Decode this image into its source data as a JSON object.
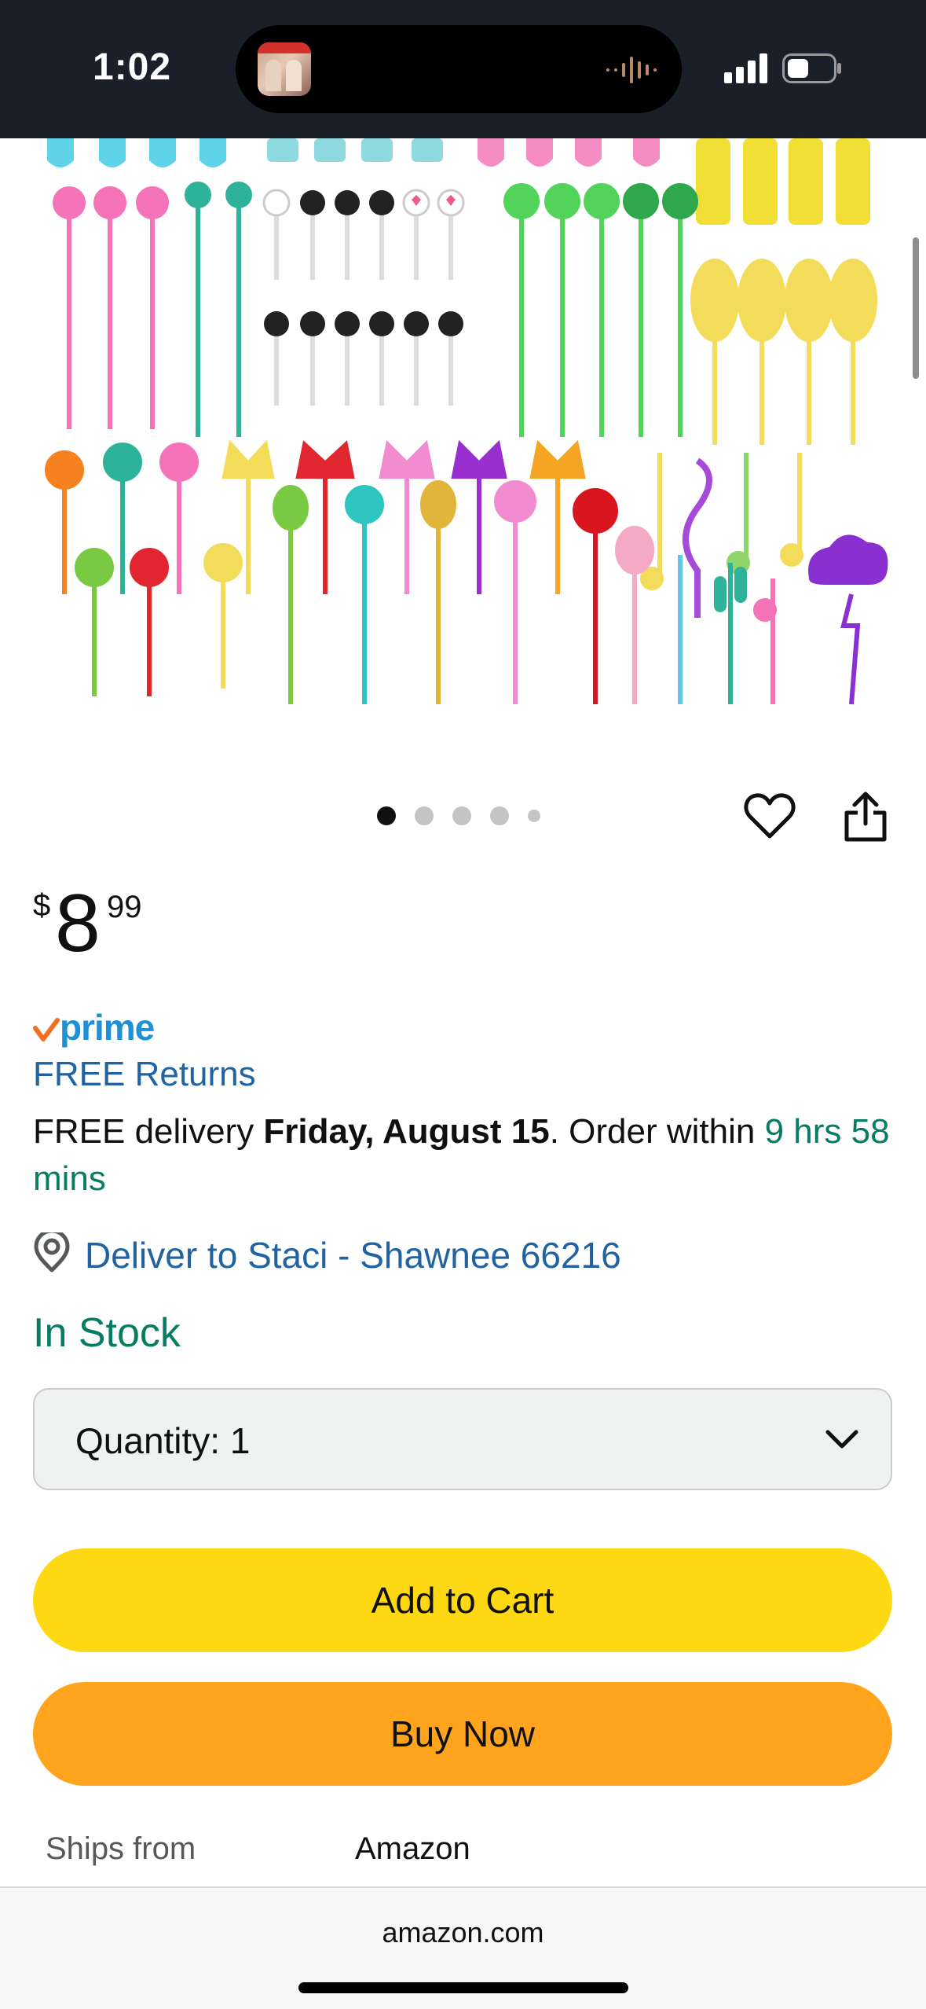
{
  "status_bar": {
    "time": "1:02",
    "icons": [
      "now-playing-thumbnail",
      "audio-waveform-icon",
      "signal-icon",
      "battery-icon"
    ]
  },
  "product": {
    "image_description_icon": "food-picks-product-image",
    "carousel": {
      "total": 5,
      "active_index": 0
    },
    "actions": [
      "heart-icon",
      "share-icon"
    ]
  },
  "price": {
    "symbol": "$",
    "whole": "8",
    "fraction": "99"
  },
  "prime": {
    "label": "prime"
  },
  "free_returns": "FREE Returns",
  "delivery": {
    "prefix": "FREE delivery ",
    "date": "Friday, August 15",
    "mid": ". Order within ",
    "countdown": "9 hrs 58 mins"
  },
  "deliver_to": "Deliver to Staci - Shawnee 66216",
  "stock_status": "In Stock",
  "quantity": {
    "label": "Quantity:",
    "value": "1"
  },
  "buttons": {
    "add_to_cart": "Add to Cart",
    "buy_now": "Buy Now"
  },
  "ships_from": {
    "label": "Ships from",
    "value": "Amazon"
  },
  "browser": {
    "url": "amazon.com"
  },
  "colors": {
    "cart_button": "#ffd814",
    "buy_button": "#ffa41c",
    "link": "#2162a1",
    "in_stock": "#067d62",
    "prime": "#1e90d6"
  }
}
